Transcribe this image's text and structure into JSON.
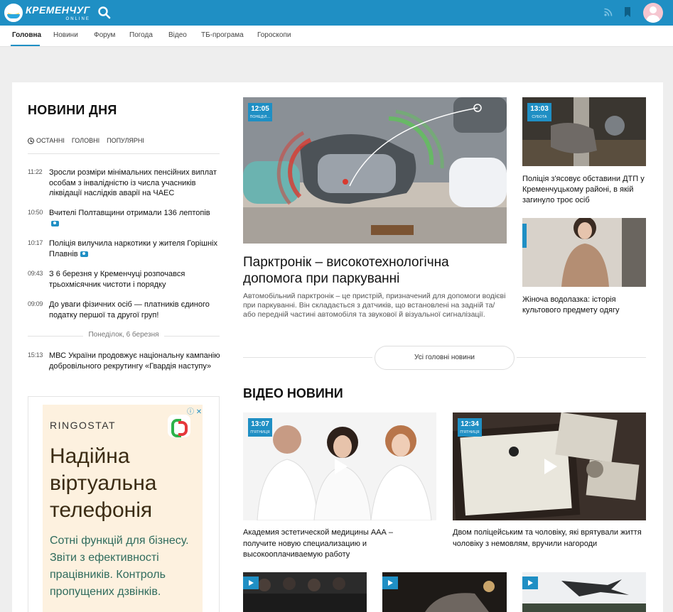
{
  "header": {
    "logo_main": "КРЕМЕНЧУГ",
    "logo_sub": "ONLINE"
  },
  "nav": {
    "items": [
      "Головна",
      "Новини",
      "Форум",
      "Погода",
      "Відео",
      "ТБ-програма",
      "Гороскопи"
    ]
  },
  "news_day": {
    "title": "НОВИНИ ДНЯ",
    "filters": [
      "ОСТАННІ",
      "ГОЛОВНІ",
      "ПОПУЛЯРНІ"
    ],
    "items": [
      {
        "time": "11:22",
        "text": "Зросли розміри мінімальних пенсійних виплат особам з інвалідністю із числа учасників ліквідації наслідків аварії на ЧАЕС"
      },
      {
        "time": "10:50",
        "text": "Вчителі Полтавщини отримали 136 лептопів"
      },
      {
        "time": "10:17",
        "text": "Поліція вилучила наркотики у жителя Горішніх Плавнів"
      },
      {
        "time": "09:43",
        "text": "З 6 березня у Кременчуці розпочався трьохмісячник чистоти і порядку"
      },
      {
        "time": "09:09",
        "text": "До уваги фізичних осіб — платників єдиного податку першої та другої груп!"
      }
    ],
    "day_separator": "Понеділок, 6 березня",
    "items2": [
      {
        "time": "15:13",
        "text": "МВС України продовжує національну кампанію добровільного рекрутингу «Гвардія наступу»"
      }
    ]
  },
  "ad": {
    "brand": "RINGOSTAT",
    "headline": "Надійна віртуальна телефонія",
    "text": "Сотні функцій для бізнесу. Звіти з ефективності працівників. Контроль пропущених дзвінків."
  },
  "featured": {
    "time": "12:05",
    "day": "ПОНЕДІЛ...",
    "title": "Парктронік – високотехнологічна допомога при паркуванні",
    "lead": "Автомобільний парктронік – це пристрій, призначений для допомоги водієві при паркуванні. Він складається з датчиків, що встановлені на задній та/або передній частині автомобіля та звукової й візуальної сигналізації."
  },
  "side_news": [
    {
      "time": "13:03",
      "day": "СУБОТА",
      "title": "Поліція з'ясовує обставини ДТП у Кременчуцькому районі, в якій загинуло троє осіб"
    },
    {
      "title": "Жіноча водолазка: історія культового предмету одягу"
    }
  ],
  "more_button": "Усі головні новини",
  "video": {
    "title": "ВІДЕО НОВИНИ",
    "items": [
      {
        "time": "13:07",
        "day": "П'ЯТНИЦЯ",
        "title": "Академия эстетической медицины ААА – получите новую специализацию и высокооплачиваемую работу"
      },
      {
        "time": "12:34",
        "day": "П'ЯТНИЦЯ",
        "title": "Двом поліцейським та чоловіку, які врятували життя чоловіку з немовлям, вручили нагороди"
      }
    ]
  },
  "colors": {
    "brand": "#1f8fc4",
    "page_bg": "#eeeeee"
  }
}
